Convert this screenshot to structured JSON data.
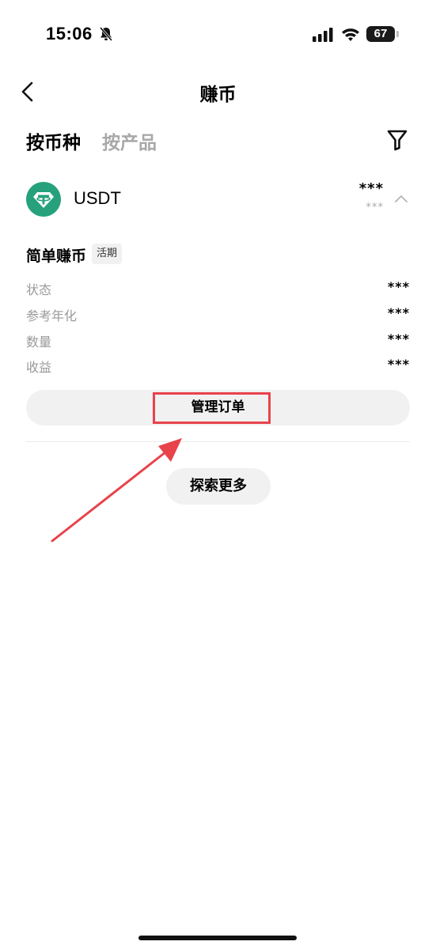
{
  "status_bar": {
    "time": "15:06",
    "battery": "67"
  },
  "nav": {
    "title": "赚币"
  },
  "tabs": [
    {
      "label": "按币种",
      "active": true
    },
    {
      "label": "按产品",
      "active": false
    }
  ],
  "coin": {
    "name": "USDT",
    "amount": "***",
    "amount_sub": "***"
  },
  "product": {
    "title": "简单赚币",
    "badge": "活期",
    "rows": [
      {
        "label": "状态",
        "value": "***"
      },
      {
        "label": "参考年化",
        "value": "***"
      },
      {
        "label": "数量",
        "value": "***"
      },
      {
        "label": "收益",
        "value": "***"
      }
    ]
  },
  "actions": {
    "manage": "管理订单",
    "explore": "探索更多"
  },
  "colors": {
    "accent_red": "#e8424a",
    "usdt_green": "#26a17b",
    "muted": "#a8a8a8",
    "button_bg": "#f1f1f1"
  }
}
